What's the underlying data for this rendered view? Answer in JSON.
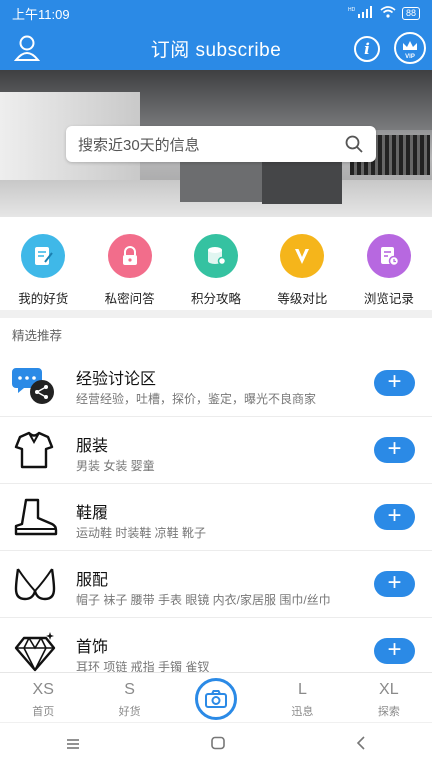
{
  "status": {
    "time": "上午11:09",
    "signal_text": "HD",
    "battery": "88"
  },
  "header": {
    "title": "订阅 subscribe",
    "vip_label": "VIP"
  },
  "search": {
    "placeholder": "搜索近30天的信息"
  },
  "quick_links": [
    {
      "label": "我的好货",
      "icon": "notepad-icon",
      "color": "#3fb8e8"
    },
    {
      "label": "私密问答",
      "icon": "lock-icon",
      "color": "#f26d8b"
    },
    {
      "label": "积分攻略",
      "icon": "database-icon",
      "color": "#35c2a1"
    },
    {
      "label": "等级对比",
      "icon": "v-badge-icon",
      "color": "#f5b51b"
    },
    {
      "label": "浏览记录",
      "icon": "history-doc-icon",
      "color": "#b768e0"
    }
  ],
  "section_label": "精选推荐",
  "categories": [
    {
      "title": "经验讨论区",
      "desc": "经营经验，吐槽，探价，鉴定，曝光不良商家",
      "icon": "chat-share-icon"
    },
    {
      "title": "服装",
      "desc": "男装 女装 婴童",
      "icon": "shirt-icon"
    },
    {
      "title": "鞋履",
      "desc": "运动鞋 时装鞋 凉鞋 靴子",
      "icon": "boot-icon"
    },
    {
      "title": "服配",
      "desc": "帽子 袜子 腰带 手表 眼镜 内衣/家居服 围巾/丝巾",
      "icon": "bra-icon"
    },
    {
      "title": "首饰",
      "desc": "耳环 项链 戒指 手镯 雀钗",
      "icon": "diamond-icon"
    }
  ],
  "add_label": "+",
  "tabs": [
    {
      "key": "XS",
      "label": "首页"
    },
    {
      "key": "S",
      "label": "好货"
    },
    {
      "key": "",
      "label": ""
    },
    {
      "key": "L",
      "label": "迅息"
    },
    {
      "key": "XL",
      "label": "探索"
    }
  ],
  "colors": {
    "primary": "#2b8ae6"
  }
}
